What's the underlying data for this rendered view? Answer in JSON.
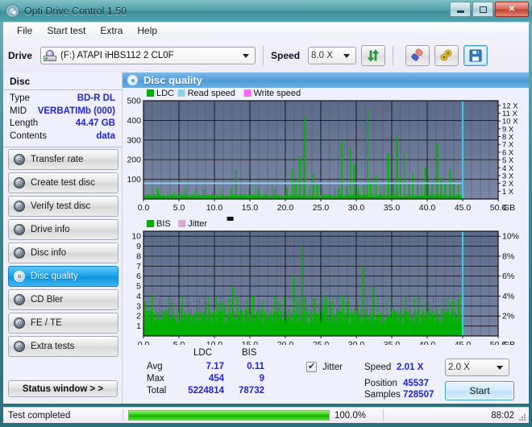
{
  "window": {
    "title": "Opti Drive Control 1.50",
    "icon": "disc-icon",
    "minimize": "minimize-icon",
    "maximize": "maximize-icon",
    "close": "close-icon"
  },
  "menu": {
    "items": [
      "File",
      "Start test",
      "Extra",
      "Help"
    ]
  },
  "toolbar": {
    "drive_label": "Drive",
    "drive_value": "(F:)  ATAPI iHBS112  2 CL0F",
    "speed_label": "Speed",
    "speed_value": "8.0 X",
    "refresh_icon": "refresh-arrows-icon",
    "eraser_icon": "eraser-icon",
    "settings_icon": "tools-icon",
    "save_icon": "save-disk-icon"
  },
  "sidebar": {
    "disc_header": "Disc",
    "disc_info": [
      {
        "key": "Type",
        "value": "BD-R DL"
      },
      {
        "key": "MID",
        "value": "VERBATIMb (000)"
      },
      {
        "key": "Length",
        "value": "44.47 GB"
      },
      {
        "key": "Contents",
        "value": "data"
      }
    ],
    "items": [
      {
        "label": "Transfer rate",
        "selected": false
      },
      {
        "label": "Create test disc",
        "selected": false
      },
      {
        "label": "Verify test disc",
        "selected": false
      },
      {
        "label": "Drive info",
        "selected": false
      },
      {
        "label": "Disc info",
        "selected": false
      },
      {
        "label": "Disc quality",
        "selected": true
      },
      {
        "label": "CD Bler",
        "selected": false
      },
      {
        "label": "FE / TE",
        "selected": false
      },
      {
        "label": "Extra tests",
        "selected": false
      }
    ],
    "status_window_button": "Status window > >"
  },
  "panel": {
    "title": "Disc quality",
    "icon": "disc-quality-icon"
  },
  "stats": {
    "col_headers": [
      "LDC",
      "BIS"
    ],
    "rows": [
      {
        "label": "Avg",
        "ldc": "7.17",
        "bis": "0.11"
      },
      {
        "label": "Max",
        "ldc": "454",
        "bis": "9"
      },
      {
        "label": "Total",
        "ldc": "5224814",
        "bis": "78732"
      }
    ],
    "jitter_checkbox_label": "Jitter",
    "jitter_checked": true,
    "speed_label": "Speed",
    "speed_value": "2.01 X",
    "speed_select": "2.0 X",
    "position_label": "Position",
    "position_value": "45537",
    "samples_label": "Samples",
    "samples_value": "728507",
    "start_button": "Start"
  },
  "statusbar": {
    "message": "Test completed",
    "progress_percent": "100.0%",
    "progress_value": 100,
    "elapsed": "88:02"
  },
  "colors": {
    "ldc": "#00b000",
    "bis": "#00b000",
    "read_speed": "#8ed0f0",
    "write_speed": "#ff66ff",
    "jitter": "#d9a8d9",
    "plot_bg_top": "#5e6d8c",
    "plot_bg_bottom": "#6b7a99",
    "accent_blue": "#1ba3ea",
    "value_blue": "#2323d6"
  },
  "chart_data": [
    {
      "type": "line",
      "name": "disc-quality-ldc-chart",
      "title": "",
      "xlabel": "GB",
      "ylabel": "LDC",
      "x": [
        0.0,
        50.0
      ],
      "xlim": [
        0.0,
        50.0
      ],
      "xticks": [
        "0.0",
        "5.0",
        "10.0",
        "15.0",
        "20.0",
        "25.0",
        "30.0",
        "35.0",
        "40.0",
        "45.0",
        "50.0"
      ],
      "xunit": "GB",
      "ylim": [
        0,
        500
      ],
      "yticks": [
        "100",
        "200",
        "300",
        "400",
        "500"
      ],
      "y2lim": [
        0,
        12
      ],
      "y2ticks": [
        "1 X",
        "2 X",
        "3 X",
        "4 X",
        "5 X",
        "6 X",
        "7 X",
        "8 X",
        "9 X",
        "10 X",
        "11 X",
        "12 X"
      ],
      "legend": [
        {
          "name": "LDC",
          "color": "#00b000"
        },
        {
          "name": "Read speed",
          "color": "#8ed0f0"
        },
        {
          "name": "Write speed",
          "color": "#ff66ff"
        }
      ],
      "legend_position": "top-left",
      "grid": true,
      "data_end_gb": 45.0,
      "series": [
        {
          "name": "LDC",
          "color": "#00b000",
          "baseline": 18,
          "spikes": [
            [
              2.1,
              55
            ],
            [
              3.4,
              42
            ],
            [
              4.6,
              38
            ],
            [
              5.9,
              60
            ],
            [
              7.2,
              44
            ],
            [
              8.6,
              50
            ],
            [
              9.8,
              40
            ],
            [
              11.0,
              46
            ],
            [
              12.3,
              52
            ],
            [
              13.1,
              150
            ],
            [
              14.2,
              48
            ],
            [
              15.0,
              44
            ],
            [
              16.3,
              56
            ],
            [
              17.1,
              42
            ],
            [
              18.4,
              50
            ],
            [
              19.6,
              45
            ],
            [
              20.2,
              58
            ],
            [
              21.0,
              155
            ],
            [
              21.6,
              95
            ],
            [
              22.1,
              215
            ],
            [
              22.8,
              420
            ],
            [
              23.4,
              60
            ],
            [
              24.0,
              130
            ],
            [
              24.6,
              70
            ],
            [
              25.2,
              55
            ],
            [
              26.2,
              48
            ],
            [
              27.0,
              60
            ],
            [
              27.6,
              52
            ],
            [
              28.0,
              290
            ],
            [
              28.6,
              62
            ],
            [
              29.2,
              260
            ],
            [
              29.8,
              175
            ],
            [
              30.3,
              58
            ],
            [
              31.0,
              70
            ],
            [
              31.6,
              454
            ],
            [
              32.1,
              90
            ],
            [
              32.8,
              120
            ],
            [
              33.4,
              66
            ],
            [
              34.0,
              78
            ],
            [
              34.6,
              230
            ],
            [
              35.2,
              90
            ],
            [
              35.8,
              320
            ],
            [
              36.2,
              110
            ],
            [
              36.8,
              240
            ],
            [
              37.4,
              80
            ],
            [
              38.0,
              130
            ],
            [
              38.6,
              95
            ],
            [
              39.2,
              70
            ],
            [
              39.8,
              160
            ],
            [
              40.2,
              120
            ],
            [
              40.8,
              90
            ],
            [
              41.4,
              285
            ],
            [
              42.0,
              110
            ],
            [
              42.6,
              85
            ],
            [
              43.2,
              150
            ],
            [
              43.8,
              95
            ],
            [
              44.4,
              70
            ]
          ]
        },
        {
          "name": "Read speed",
          "color": "#8ed0f0",
          "constant_x_speed": 2.01,
          "end_gb": 45.0
        },
        {
          "name": "Write speed",
          "color": "#ff66ff",
          "values": []
        }
      ]
    },
    {
      "type": "line",
      "name": "disc-quality-bis-jitter-chart",
      "title": "",
      "xlabel": "GB",
      "ylabel": "BIS",
      "xlim": [
        0.0,
        50.0
      ],
      "xticks": [
        "0.0",
        "5.0",
        "10.0",
        "15.0",
        "20.0",
        "25.0",
        "30.0",
        "35.0",
        "40.0",
        "45.0",
        "50.0"
      ],
      "xunit": "GB",
      "ylim": [
        0,
        10
      ],
      "yticks": [
        "1",
        "2",
        "3",
        "4",
        "5",
        "6",
        "7",
        "8",
        "9",
        "10"
      ],
      "y2lim": [
        0,
        10
      ],
      "y2ticks": [
        "2%",
        "4%",
        "6%",
        "8%",
        "10%"
      ],
      "legend": [
        {
          "name": "BIS",
          "color": "#00b000"
        },
        {
          "name": "Jitter",
          "color": "#d9a8d9"
        }
      ],
      "legend_position": "top-left",
      "grid": true,
      "data_end_gb": 45.0,
      "series": [
        {
          "name": "BIS",
          "color": "#00b000",
          "baseline": 2.2,
          "spikes": [
            [
              1.2,
              4
            ],
            [
              2.4,
              3.6
            ],
            [
              3.6,
              4
            ],
            [
              4.4,
              3.3
            ],
            [
              5.6,
              4
            ],
            [
              6.8,
              3.5
            ],
            [
              7.9,
              4
            ],
            [
              9.1,
              3.4
            ],
            [
              10.2,
              4
            ],
            [
              11.4,
              3.6
            ],
            [
              12.6,
              5
            ],
            [
              13.4,
              4
            ],
            [
              14.6,
              3.7
            ],
            [
              15.8,
              4
            ],
            [
              17.0,
              3.5
            ],
            [
              18.2,
              4
            ],
            [
              19.4,
              3.6
            ],
            [
              20.0,
              4
            ],
            [
              21.2,
              6
            ],
            [
              21.8,
              4
            ],
            [
              22.4,
              9
            ],
            [
              23.0,
              4
            ],
            [
              24.2,
              3.7
            ],
            [
              25.4,
              4
            ],
            [
              26.0,
              3.6
            ],
            [
              27.2,
              4
            ],
            [
              28.4,
              3.8
            ],
            [
              29.0,
              4
            ],
            [
              30.2,
              3.6
            ],
            [
              31.0,
              7
            ],
            [
              31.8,
              4
            ],
            [
              32.4,
              5
            ],
            [
              33.0,
              4
            ],
            [
              34.2,
              3.7
            ],
            [
              35.0,
              4
            ],
            [
              36.2,
              3.6
            ],
            [
              37.0,
              4
            ],
            [
              38.2,
              3.8
            ],
            [
              39.0,
              4
            ],
            [
              40.2,
              3.6
            ],
            [
              41.0,
              4
            ],
            [
              42.2,
              3.7
            ],
            [
              43.0,
              4
            ],
            [
              44.2,
              3.6
            ]
          ]
        },
        {
          "name": "Jitter",
          "color": "#d9a8d9",
          "values": []
        }
      ]
    }
  ]
}
